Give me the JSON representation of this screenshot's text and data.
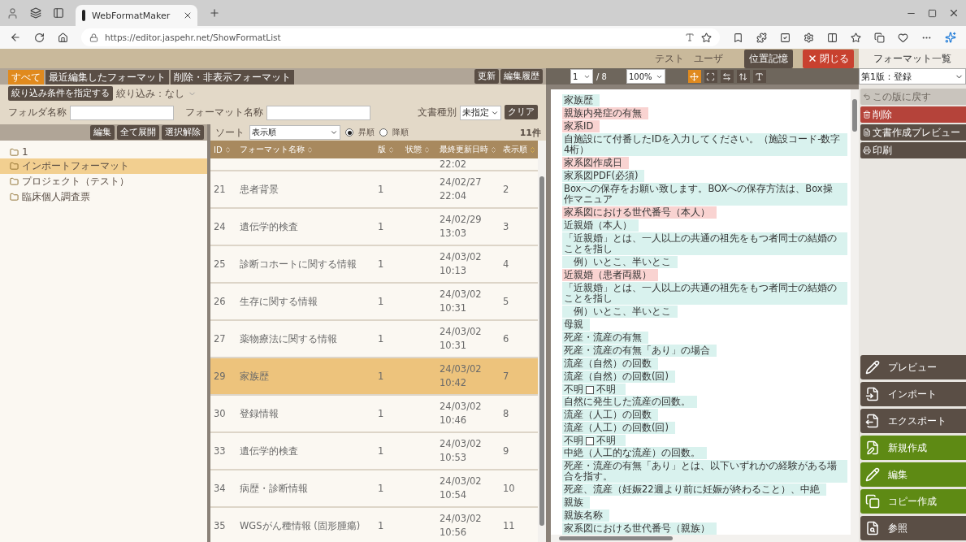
{
  "browser": {
    "tab_title": "WebFormatMaker",
    "url": "https://editor.jaspehr.net/ShowFormatList"
  },
  "header": {
    "user": "テスト　ユーザ",
    "memory_button": "位置記憶",
    "close_button": "閉じる",
    "panel_title": "フォーマット一覧"
  },
  "tabs": [
    {
      "label": "すべて",
      "selected": true
    },
    {
      "label": "最近編集したフォーマット",
      "selected": false
    },
    {
      "label": "削除・非表示フォーマット",
      "selected": false
    }
  ],
  "tab_actions": [
    "更新",
    "編集履歴"
  ],
  "filter": {
    "button": "絞り込み条件を指定する",
    "status": "絞り込み：なし"
  },
  "fields": [
    {
      "label": "フォルダ名称"
    },
    {
      "label": "フォーマット名称"
    }
  ],
  "doc_type": {
    "label": "文書種別",
    "value": "未指定"
  },
  "clear_button": "クリア",
  "folder_tree": {
    "actions": [
      "編集",
      "全て展開",
      "選択解除"
    ],
    "items": [
      {
        "label": "1",
        "selected": false
      },
      {
        "label": "インポートフォーマット",
        "selected": true
      },
      {
        "label": "プロジェクト（テスト）",
        "selected": false
      },
      {
        "label": "臨床個人調査票",
        "selected": false
      }
    ]
  },
  "table": {
    "sort_label": "ソート",
    "sort_value": "表示順",
    "order": [
      {
        "label": "昇順",
        "selected": true
      },
      {
        "label": "降順",
        "selected": false
      }
    ],
    "count": "11件",
    "columns": [
      {
        "label": "ID",
        "sorted": false
      },
      {
        "label": "フォーマット名称",
        "sorted": false
      },
      {
        "label": "版",
        "sorted": false
      },
      {
        "label": "状態",
        "sorted": false
      },
      {
        "label": "最終更新日時",
        "sorted": false
      },
      {
        "label": "表示順",
        "sorted": true
      }
    ],
    "partial_row_time": "22:02",
    "rows": [
      {
        "id": "21",
        "name": "患者背景",
        "version": "1",
        "date": "24/02/27",
        "time": "22:04",
        "order": "2",
        "selected": false
      },
      {
        "id": "24",
        "name": "遺伝学的検査",
        "version": "1",
        "date": "24/02/29",
        "time": "13:03",
        "order": "3",
        "selected": false
      },
      {
        "id": "25",
        "name": "診断コホートに関する情報",
        "version": "1",
        "date": "24/03/02",
        "time": "10:13",
        "order": "4",
        "selected": false
      },
      {
        "id": "26",
        "name": "生存に関する情報",
        "version": "1",
        "date": "24/03/02",
        "time": "10:31",
        "order": "5",
        "selected": false
      },
      {
        "id": "27",
        "name": "薬物療法に関する情報",
        "version": "1",
        "date": "24/03/02",
        "time": "10:31",
        "order": "6",
        "selected": false
      },
      {
        "id": "29",
        "name": "家族歴",
        "version": "1",
        "date": "24/03/02",
        "time": "10:42",
        "order": "7",
        "selected": true
      },
      {
        "id": "30",
        "name": "登録情報",
        "version": "1",
        "date": "24/03/02",
        "time": "10:46",
        "order": "8",
        "selected": false
      },
      {
        "id": "33",
        "name": "遺伝学的検査",
        "version": "1",
        "date": "24/03/02",
        "time": "10:53",
        "order": "9",
        "selected": false
      },
      {
        "id": "34",
        "name": "病歴・診断情報",
        "version": "1",
        "date": "24/03/02",
        "time": "10:54",
        "order": "10",
        "selected": false
      },
      {
        "id": "35",
        "name": "WGSがん種情報 (固形腫瘍)",
        "version": "1",
        "date": "24/03/02",
        "time": "10:56",
        "order": "11",
        "selected": false
      }
    ]
  },
  "preview": {
    "page": "1",
    "pages": "/ 8",
    "zoom": "100%",
    "view_modes": [
      {
        "selected": true
      },
      {
        "selected": false
      },
      {
        "selected": false
      },
      {
        "selected": false
      },
      {
        "selected": false
      }
    ],
    "items": [
      {
        "kind": "text",
        "text": "家族歴",
        "color": "#d9f2ee"
      },
      {
        "kind": "text",
        "text": "親族内発症の有無",
        "color": "#f9d3d1"
      },
      {
        "kind": "text",
        "text": "家系ID",
        "color": "#f9d3d1"
      },
      {
        "kind": "text",
        "text": "自施設にて付番したIDを入力してください。（施設コード-数字4桁）",
        "color": "#d9f2ee"
      },
      {
        "kind": "text",
        "text": "家系図作成日",
        "color": "#f9d3d1"
      },
      {
        "kind": "text",
        "text": "家系図PDF(必須)",
        "color": "#d9f2ee"
      },
      {
        "kind": "text",
        "text": "Boxへの保存をお願い致します。BOXへの保存方法は、Box操作マニュア",
        "color": "#d9f2ee"
      },
      {
        "kind": "text",
        "text": "家系図における世代番号（本人）",
        "color": "#f9d3d1"
      },
      {
        "kind": "text",
        "text": "近親婚（本人）",
        "color": "#d9f2ee"
      },
      {
        "kind": "text",
        "text": "「近親婚」とは、一人以上の共通の祖先をもつ者同士の結婚のことを指し",
        "color": "#d9f2ee"
      },
      {
        "kind": "indent",
        "text": "例）いとこ、半いとこ",
        "color": "#d9f2ee"
      },
      {
        "kind": "text",
        "text": "近親婚（患者両親）",
        "color": "#f9d3d1"
      },
      {
        "kind": "text",
        "text": "「近親婚」とは、一人以上の共通の祖先をもつ者同士の結婚のことを指し",
        "color": "#d9f2ee"
      },
      {
        "kind": "indent",
        "text": "例）いとこ、半いとこ",
        "color": "#d9f2ee"
      },
      {
        "kind": "text",
        "text": "母親",
        "color": "#d9f2ee"
      },
      {
        "kind": "text",
        "text": "死産・流産の有無",
        "color": "#d9f2ee"
      },
      {
        "kind": "text",
        "text": "死産・流産の有無「あり」の場合",
        "color": "#d9f2ee"
      },
      {
        "kind": "text",
        "text": "流産（自然）の回数",
        "color": "#d9f2ee"
      },
      {
        "kind": "text",
        "text": "流産（自然）の回数(回)",
        "color": "#d9f2ee"
      },
      {
        "kind": "checkbox",
        "text": "不明",
        "option": "不明",
        "checked": false,
        "color": "#d9f2ee"
      },
      {
        "kind": "text",
        "text": "自然に発生した流産の回数。",
        "color": "#d9f2ee"
      },
      {
        "kind": "text",
        "text": "流産（人工）の回数",
        "color": "#d9f2ee"
      },
      {
        "kind": "text",
        "text": "流産（人工）の回数(回)",
        "color": "#d9f2ee"
      },
      {
        "kind": "checkbox",
        "text": "不明",
        "option": "不明",
        "checked": false,
        "color": "#d9f2ee"
      },
      {
        "kind": "text",
        "text": "中絶（人工的な流産）の回数。",
        "color": "#d9f2ee"
      },
      {
        "kind": "text",
        "text": "死産・流産の有無「あり」とは、以下いずれかの経験がある場合を指す。",
        "color": "#d9f2ee"
      },
      {
        "kind": "text",
        "text": "死産、流産（妊娠22週より前に妊娠が終わること）、中絶",
        "color": "#d9f2ee"
      },
      {
        "kind": "text",
        "text": "親族",
        "color": "#d9f2ee"
      },
      {
        "kind": "text",
        "text": "親族名称",
        "color": "#d9f2ee"
      },
      {
        "kind": "text",
        "text": "家系図における世代番号（親族）",
        "color": "#d9f2ee"
      }
    ]
  },
  "sidebar": {
    "version": "第1版：登録",
    "actions": [
      {
        "label": "この版に戻す",
        "disabled": true,
        "color": "#c9c4bd"
      },
      {
        "label": "削除",
        "disabled": false,
        "color": "#b5433a"
      },
      {
        "label": "文書作成プレビュー",
        "disabled": false,
        "color": "#5a4e45"
      },
      {
        "label": "印刷",
        "disabled": false,
        "color": "#5a4e45"
      }
    ],
    "main_actions": [
      {
        "label": "プレビュー",
        "color": "#5a4e45"
      },
      {
        "label": "インポート",
        "color": "#5a4e45"
      },
      {
        "label": "エクスポート",
        "color": "#5a4e45"
      },
      {
        "label": "新規作成",
        "color": "#5e8a14"
      },
      {
        "label": "編集",
        "color": "#5e8a14"
      },
      {
        "label": "コピー作成",
        "color": "#5e8a14"
      },
      {
        "label": "参照",
        "color": "#5a4e45"
      }
    ]
  }
}
